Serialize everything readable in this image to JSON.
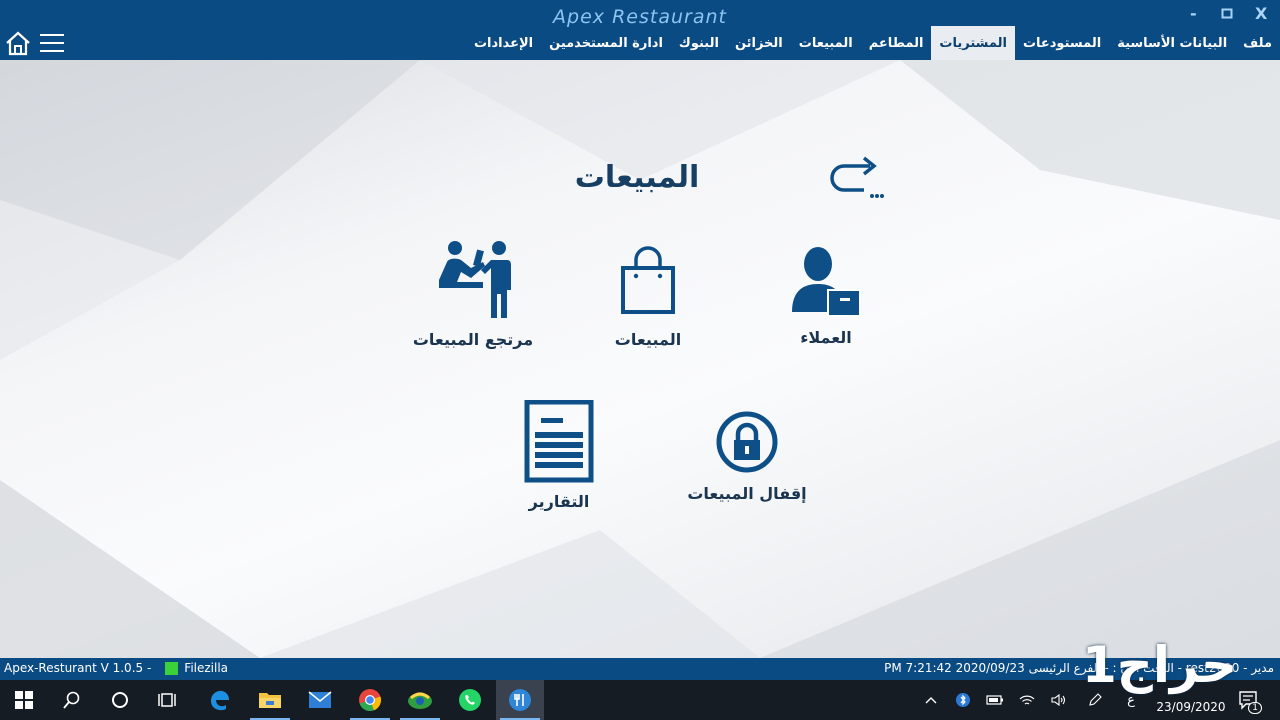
{
  "window": {
    "title": "Apex Restaurant",
    "minimize_label": "-",
    "maximize_label": "▫",
    "close_label": "X"
  },
  "menu": [
    {
      "label": "ملف"
    },
    {
      "label": "البيانات الأساسية"
    },
    {
      "label": "المستودعات"
    },
    {
      "label": "المشتريات",
      "active": true
    },
    {
      "label": "المطاعم"
    },
    {
      "label": "المبيعات"
    },
    {
      "label": "الخزائن"
    },
    {
      "label": "البنوك"
    },
    {
      "label": "ادارة المستخدمين"
    },
    {
      "label": "الإعدادات"
    }
  ],
  "page": {
    "title": "المبيعات",
    "tiles": {
      "customers": "العملاء",
      "sales": "المبيعات",
      "sales_return": "مرتجع المبيعات",
      "sales_closing": "إقفال المبيعات",
      "reports": "التقارير"
    }
  },
  "status": {
    "version": "Apex-Resturant V 1.0.5  -",
    "ftp": "Filezilla",
    "info": "PM 7:21:42 2020/09/23 الوقت الآن :  -  الفرع الرئيسى  -  rest2020 - مدير"
  },
  "taskbar": {
    "date": "23/09/2020",
    "notification_count": "1",
    "lang": "ع"
  },
  "watermark": "حراج1",
  "colors": {
    "primary": "#0b4b84",
    "icon": "#0d4f86",
    "title_text": "#173f63"
  }
}
